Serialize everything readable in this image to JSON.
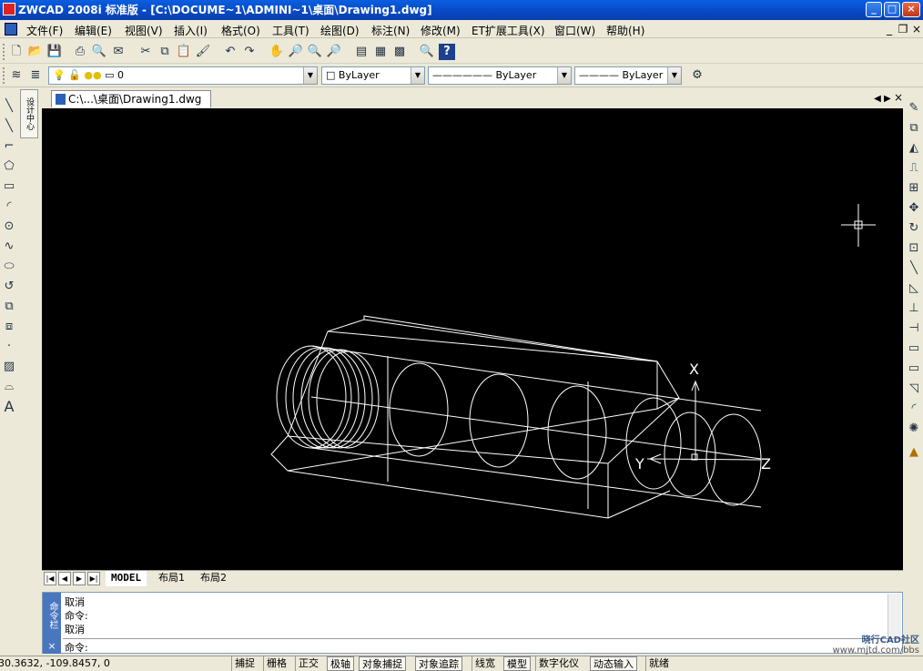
{
  "window": {
    "title": "ZWCAD 2008i 标准版 - [C:\\DOCUME~1\\ADMINI~1\\桌面\\Drawing1.dwg]"
  },
  "menubar": {
    "items": [
      "文件(F)",
      "编辑(E)",
      "视图(V)",
      "插入(I)",
      "格式(O)",
      "工具(T)",
      "绘图(D)",
      "标注(N)",
      "修改(M)",
      "ET扩展工具(X)",
      "窗口(W)",
      "帮助(H)"
    ]
  },
  "layers": {
    "current": "0"
  },
  "properties": {
    "color": "ByLayer",
    "linetype": "ByLayer",
    "lineweight": "ByLayer"
  },
  "design_center": {
    "label": "设计中心"
  },
  "document_tab": {
    "label": "C:\\...\\桌面\\Drawing1.dwg"
  },
  "ucs": {
    "x": "X",
    "y": "Y",
    "z": "Z"
  },
  "layout_tabs": [
    "MODEL",
    "布局1",
    "布局2"
  ],
  "command": {
    "label": "命令栏",
    "history": [
      "取消",
      "命令:",
      "取消"
    ],
    "prompt": "命令:"
  },
  "status": {
    "coords": "30.3632,  -109.8457,  0",
    "buttons": [
      "捕捉",
      "栅格",
      "正交",
      "极轴",
      "对象捕捉",
      "对象追踪",
      "线宽",
      "模型",
      "数字化仪",
      "动态输入",
      "就绪"
    ]
  },
  "watermark": {
    "line1": "晓行CAD社区",
    "line2": "www.mjtd.com/bbs"
  }
}
